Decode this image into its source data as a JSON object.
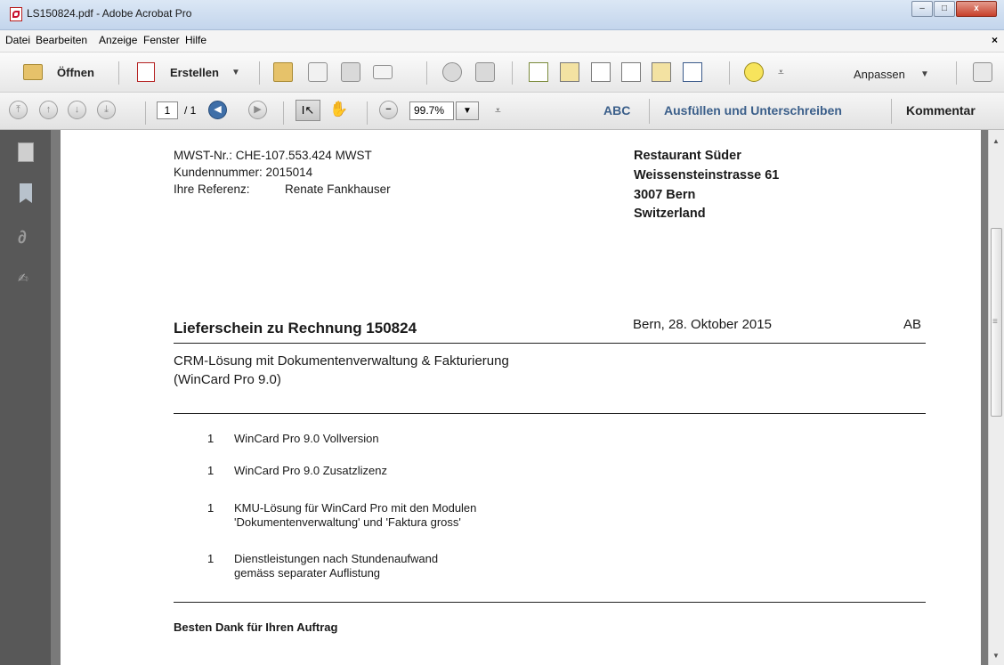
{
  "window": {
    "title": "LS150824.pdf - Adobe Acrobat Pro",
    "min_label": "–",
    "max_label": "□",
    "close_label": "x"
  },
  "menu": {
    "items": [
      "Datei",
      "Bearbeiten",
      "Anzeige",
      "Fenster",
      "Hilfe"
    ],
    "close": "×"
  },
  "toolbar": {
    "open_label": "Öffnen",
    "create_label": "Erstellen",
    "customize_label": "Anpassen"
  },
  "nav": {
    "page_value": "1",
    "page_total": "/ 1",
    "zoom_value": "99.7%"
  },
  "tools": {
    "abc": "ABC",
    "fill_sign": "Ausfüllen und Unterschreiben",
    "comment": "Kommentar"
  },
  "document": {
    "vat_no": "MWST-Nr.: CHE-107.553.424 MWST",
    "customer_no": "Kundennummer:  2015014",
    "reference_label": "Ihre Referenz:",
    "reference_value": "Renate Fankhauser",
    "address": [
      "Restaurant Süder",
      "Weissensteinstrasse 61",
      "3007 Bern",
      "Switzerland"
    ],
    "heading": "Lieferschein zu Rechnung   150824",
    "date": "Bern, 28. Oktober 2015",
    "initials": "AB",
    "subject_line1": "CRM-Lösung mit Dokumentenverwaltung & Fakturierung",
    "subject_line2": "(WinCard Pro 9.0)",
    "items": [
      {
        "qty": "1",
        "line1": "WinCard Pro 9.0  Vollversion",
        "line2": ""
      },
      {
        "qty": "1",
        "line1": "WinCard Pro 9.0  Zusatzlizenz",
        "line2": ""
      },
      {
        "qty": "1",
        "line1": "KMU-Lösung für WinCard Pro mit den Modulen",
        "line2": "'Dokumentenverwaltung' und 'Faktura gross'"
      },
      {
        "qty": "1",
        "line1": "Dienstleistungen nach Stundenaufwand",
        "line2": "gemäss separater Auflistung"
      }
    ],
    "thanks": "Besten Dank für Ihren Auftrag"
  }
}
